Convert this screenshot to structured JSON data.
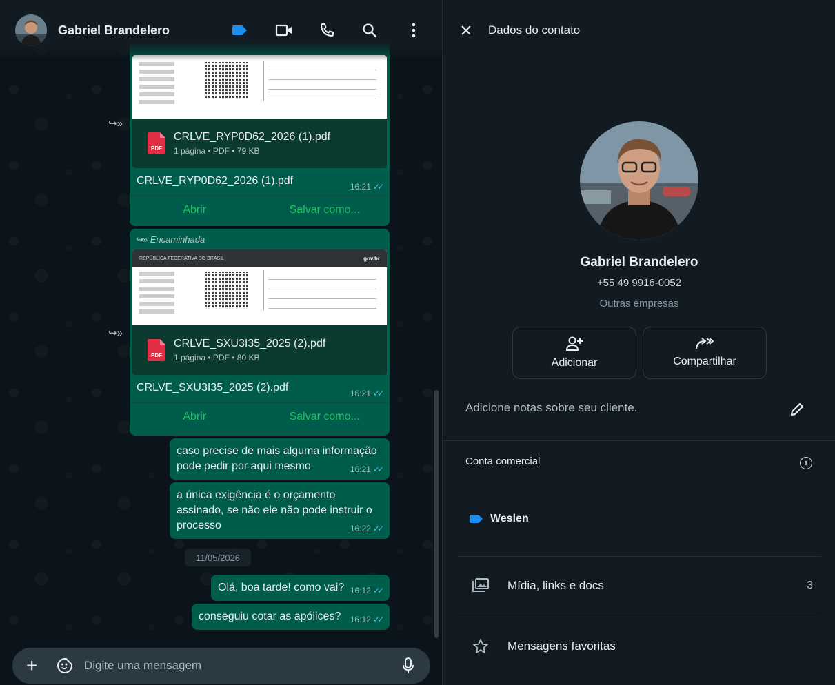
{
  "chat": {
    "contact_name": "Gabriel Brandelero",
    "header_icons": [
      "label-icon",
      "video-call-icon",
      "voice-call-icon",
      "search-icon",
      "more-options-icon"
    ],
    "forwarded_label": "Encaminhada",
    "documents": [
      {
        "file_name": "CRLVE_RYP0D62_2026 (1).pdf",
        "file_info": "1 página • PDF • 79 KB",
        "caption": "CRLVE_RYP0D62_2026 (1).pdf",
        "time": "16:21",
        "open_label": "Abrir",
        "save_label": "Salvar como...",
        "forwarded": false
      },
      {
        "file_name": "CRLVE_SXU3I35_2025 (2).pdf",
        "file_info": "1 página • PDF • 80 KB",
        "caption": "CRLVE_SXU3I35_2025 (2).pdf",
        "time": "16:21",
        "open_label": "Abrir",
        "save_label": "Salvar como...",
        "forwarded": true
      }
    ],
    "doc_header_text": "REPÚBLICA FEDERATIVA DO BRASIL",
    "doc_brand": "gov.br",
    "messages": [
      {
        "lines": [
          "caso precise de mais alguma informação",
          "pode pedir por aqui mesmo"
        ],
        "time": "16:21"
      },
      {
        "lines": [
          "a única exigência é o orçamento",
          "assinado, se não ele não pode instruir o",
          "processo"
        ],
        "time": "16:22"
      },
      {
        "lines": [
          "Olá, boa tarde! como vai?"
        ],
        "time": "16:12"
      },
      {
        "lines": [
          "conseguiu cotar as apólices?"
        ],
        "time": "16:12"
      }
    ],
    "date_separator": "11/05/2026",
    "composer_placeholder": "Digite uma mensagem"
  },
  "contact_panel": {
    "title": "Dados do contato",
    "name": "Gabriel Brandelero",
    "phone": "+55 49 9916-0052",
    "category": "Outras empresas",
    "add_label": "Adicionar",
    "share_label": "Compartilhar",
    "notes_placeholder": "Adicione notas sobre seu cliente.",
    "business_account_label": "Conta comercial",
    "label_name": "Weslen",
    "label_color": "#1b8ef2",
    "media_label": "Mídia, links e docs",
    "media_count": "3",
    "starred_label": "Mensagens favoritas"
  },
  "colors": {
    "outgoing_bubble": "#005c4b",
    "read_ticks": "#53bdeb",
    "action_green": "#25d366",
    "pdf_red": "#e02f44"
  }
}
